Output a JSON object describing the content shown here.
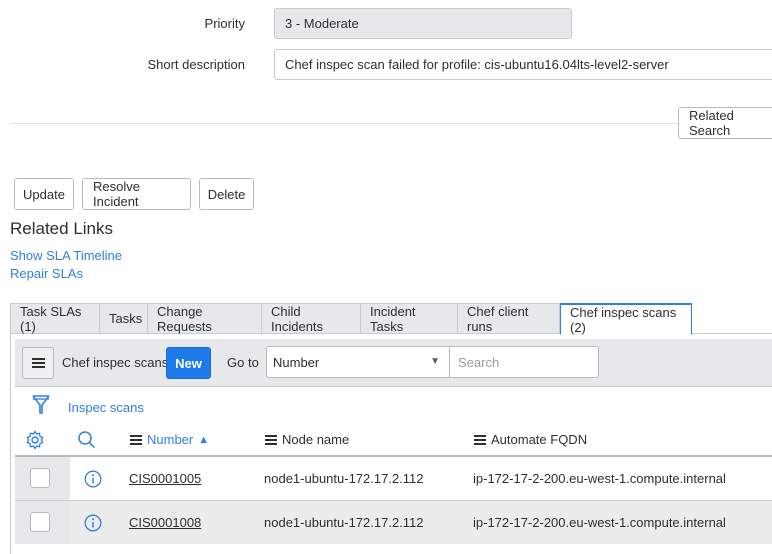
{
  "form": {
    "priority_label": "Priority",
    "priority_value": "3 - Moderate",
    "short_description_label": "Short description",
    "short_description_value": "Chef inspec scan failed for profile: cis-ubuntu16.04lts-level2-server"
  },
  "related_search_button": "Related Search",
  "actions": {
    "update": "Update",
    "resolve_incident": "Resolve Incident",
    "delete": "Delete"
  },
  "related_links": {
    "title": "Related Links",
    "items": [
      "Show SLA Timeline",
      "Repair SLAs"
    ]
  },
  "tabs": [
    {
      "label": "Task SLAs (1)",
      "active": false
    },
    {
      "label": "Tasks",
      "active": false
    },
    {
      "label": "Change Requests",
      "active": false
    },
    {
      "label": "Child Incidents",
      "active": false
    },
    {
      "label": "Incident Tasks",
      "active": false
    },
    {
      "label": "Chef client runs",
      "active": false
    },
    {
      "label": "Chef inspec scans (2)",
      "active": true
    }
  ],
  "list": {
    "title": "Chef inspec scans",
    "new_button": "New",
    "goto_label": "Go to",
    "goto_select_value": "Number",
    "search_placeholder": "Search",
    "filter_label": "Inspec scans",
    "columns": [
      {
        "label": "Number",
        "sorted": "asc"
      },
      {
        "label": "Node name"
      },
      {
        "label": "Automate FQDN"
      }
    ],
    "sort_indicator": "▲",
    "rows": [
      {
        "number": "CIS0001005",
        "node_name": "node1-ubuntu-172.17.2.112",
        "fqdn": "ip-172-17-2-200.eu-west-1.compute.internal"
      },
      {
        "number": "CIS0001008",
        "node_name": "node1-ubuntu-172.17.2.112",
        "fqdn": "ip-172-17-2-200.eu-west-1.compute.internal"
      }
    ]
  },
  "colors": {
    "accent": "#2f7fe2",
    "primary_button": "#1f7bea",
    "toolbar_bg": "#e6e8ea"
  }
}
